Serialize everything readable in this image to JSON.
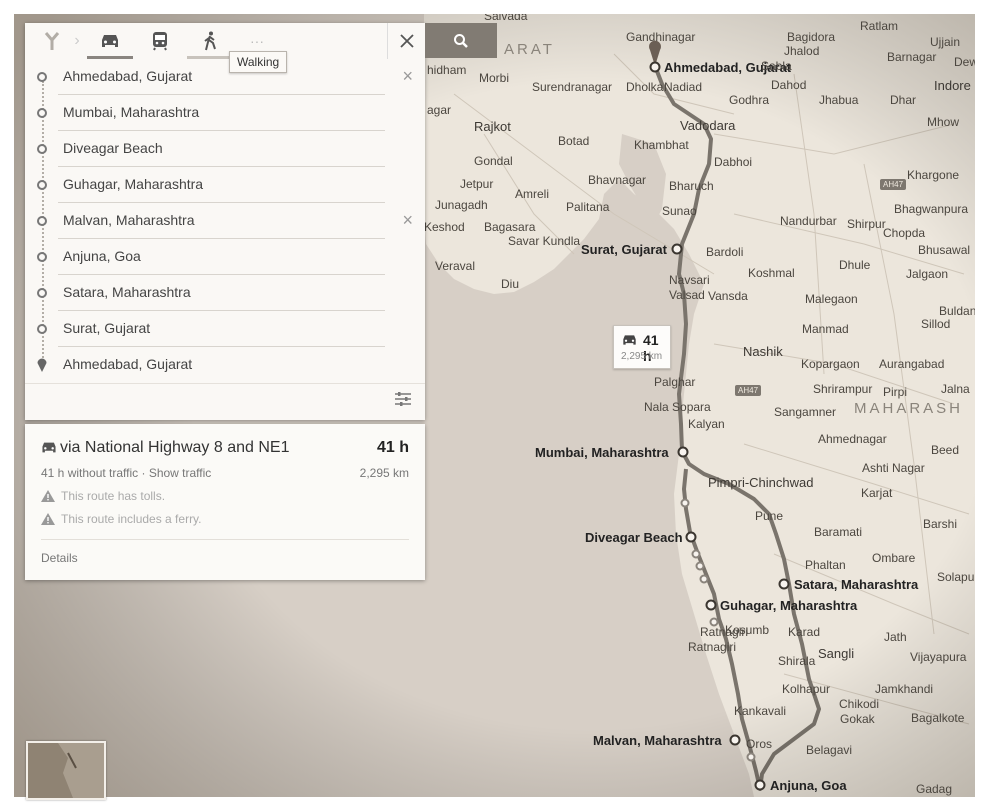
{
  "travel_modes": {
    "walking_tooltip": "Walking",
    "more": "···"
  },
  "waypoints": [
    {
      "label": "Ahmedabad, Gujarat",
      "removable": true
    },
    {
      "label": "Mumbai, Maharashtra",
      "removable": false
    },
    {
      "label": "Diveagar Beach",
      "removable": false
    },
    {
      "label": "Guhagar, Maharashtra",
      "removable": false
    },
    {
      "label": "Malvan, Maharashtra",
      "removable": true
    },
    {
      "label": "Anjuna, Goa",
      "removable": false
    },
    {
      "label": "Satara, Maharashtra",
      "removable": false
    },
    {
      "label": "Surat, Gujarat",
      "removable": false
    },
    {
      "label": "Ahmedabad, Gujarat",
      "removable": false
    }
  ],
  "route": {
    "title": "via National Highway 8 and NE1",
    "time": "41 h",
    "subtitle": "41 h without traffic · Show traffic",
    "distance": "2,295 km",
    "warnings": [
      "This route has tolls.",
      "This route includes a ferry."
    ],
    "details_link": "Details"
  },
  "route_bubble": {
    "time": "41 h",
    "distance": "2,295 km"
  },
  "map": {
    "region_label": "ARAT",
    "region_label_2": "MAHARASH",
    "stops": {
      "ahmedabad": "Ahmedabad, Gujarat",
      "surat": "Surat, Gujarat",
      "mumbai": "Mumbai, Maharashtra",
      "diveagar": "Diveagar Beach",
      "satara": "Satara, Maharashtra",
      "guhagar": "Guhagar, Maharashtra",
      "malvan": "Malvan, Maharashtra",
      "anjuna": "Anjuna, Goa"
    },
    "places": {
      "gandhinagar": "Gandhinagar",
      "nadiad": "Nadiad",
      "dholka": "Dholka",
      "surendranagar": "Surendranagar",
      "morbi": "Morbi",
      "rajkot": "Rajkot",
      "gondal": "Gondal",
      "jetpur": "Jetpur",
      "amreli": "Amreli",
      "junagadh": "Junagadh",
      "keshod": "Keshod",
      "bagasara": "Bagasara",
      "savar_kundla": "Savar Kundla",
      "veraval": "Veraval",
      "diu": "Diu",
      "botad": "Botad",
      "khambhat": "Khambhat",
      "bhavnagar": "Bhavnagar",
      "palitana": "Palitana",
      "vadodara": "Vadodara",
      "dabhoi": "Dabhoi",
      "bharuch": "Bharuch",
      "sunao": "Sunao",
      "bardoli": "Bardoli",
      "navsari": "Navsari",
      "valsad": "Valsad",
      "vansda": "Vansda",
      "palghar": "Palghar",
      "nala_sopara": "Nala Sopara",
      "kalyan": "Kalyan",
      "pimpri": "Pimpri-Chinchwad",
      "pune": "Pune",
      "kosumb": "Kosumb",
      "ratnagiri": "Ratnagiri",
      "kankavali": "Kankavali",
      "oros": "Oros",
      "belagavi": "Belagavi",
      "gadag": "Gadag",
      "godhra": "Godhra",
      "dahod": "Dahod",
      "jhabua": "Jhabua",
      "bagidora": "Bagidora",
      "jhalod": "Jhalod",
      "sabla": "Sabla",
      "ratlam": "Ratlam",
      "ujjain": "Ujjain",
      "barnagar": "Barnagar",
      "dhar": "Dhar",
      "indore": "Indore",
      "mhow": "Mhow",
      "dewas": "Dew",
      "khargone": "Khargone",
      "bhagwanpura": "Bhagwanpura",
      "nandurbar": "Nandurbar",
      "shirpur": "Shirpur",
      "chopda": "Chopda",
      "bhusawal": "Bhusawal",
      "dhule": "Dhule",
      "jalgaon": "Jalgaon",
      "koshmal": "Koshmal",
      "malegaon": "Malegaon",
      "buldana": "Buldana",
      "sillod": "Sillod",
      "manmad": "Manmad",
      "nashik": "Nashik",
      "kopargaon": "Kopargaon",
      "aurangabad": "Aurangabad",
      "shrirampur": "Shrirampur",
      "pirpi": "Pirpi",
      "jalna": "Jalna",
      "sangamner": "Sangamner",
      "ahmednagar": "Ahmednagar",
      "beed": "Beed",
      "ashti": "Ashti Nagar",
      "karjat": "Karjat",
      "baramati": "Baramati",
      "barshi": "Barshi",
      "phaltan": "Phaltan",
      "ombare": "Ombare",
      "solapur": "Solapu",
      "karad": "Karad",
      "jath": "Jath",
      "sangli": "Sangli",
      "vijayapura": "Vijayapura",
      "shirala": "Shirala",
      "kolhapur": "Kolhapur",
      "jamkhandi": "Jamkhandi",
      "chikodi": "Chikodi",
      "gokak": "Gokak",
      "bagalkote": "Bagalkote",
      "hidham": "hidham",
      "gar": "agar",
      "sabvada": "Salvada"
    },
    "shields": [
      "AH47",
      "AH47"
    ]
  }
}
